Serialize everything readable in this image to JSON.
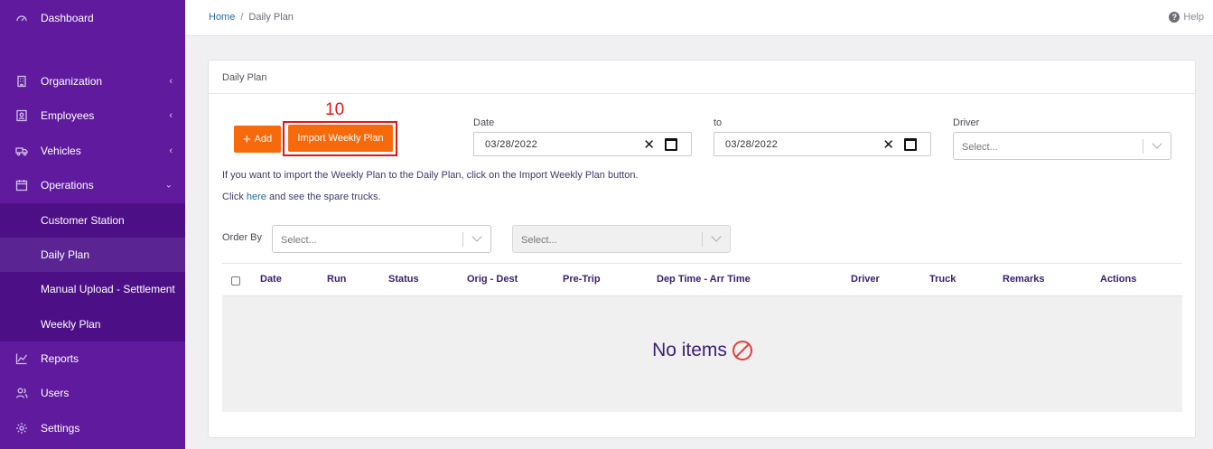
{
  "sidebar": {
    "items": [
      {
        "label": "Dashboard",
        "icon": "gauge-icon"
      },
      {
        "label": "Organization",
        "icon": "building-icon"
      },
      {
        "label": "Employees",
        "icon": "id-card-icon"
      },
      {
        "label": "Vehicles",
        "icon": "truck-icon"
      },
      {
        "label": "Operations",
        "icon": "calendar-icon"
      },
      {
        "label": "Reports",
        "icon": "chart-line-icon"
      },
      {
        "label": "Users",
        "icon": "users-icon"
      },
      {
        "label": "Settings",
        "icon": "gear-icon"
      }
    ],
    "submenu": [
      {
        "label": "Customer Station"
      },
      {
        "label": "Daily Plan",
        "active": true
      },
      {
        "label": "Manual Upload - Settlement"
      },
      {
        "label": "Weekly Plan"
      }
    ],
    "colors": {
      "bg": "#5f1a9e",
      "submenu_bg": "#4c0f86"
    }
  },
  "topbar": {
    "breadcrumb": {
      "home": "Home",
      "separator": "/",
      "current": "Daily Plan"
    },
    "help": "Help"
  },
  "card": {
    "title": "Daily Plan",
    "add_button": "Add",
    "import_button": "Import Weekly Plan",
    "step_number": "10",
    "date_label": "Date",
    "date_value": "03/28/2022",
    "to_label": "to",
    "to_value": "03/28/2022",
    "driver_label": "Driver",
    "driver_placeholder": "Select...",
    "info_line": "If you want to import the Weekly Plan to the Daily Plan, click on the Import Weekly Plan button.",
    "spare_prefix": "Click",
    "spare_link": "here",
    "spare_suffix": "and see the spare trucks.",
    "order_by_label": "Order By",
    "order_by_placeholder": "Select...",
    "order_dir_placeholder": "Select...",
    "table": {
      "columns": [
        "Date",
        "Run",
        "Status",
        "Orig - Dest",
        "Pre-Trip",
        "Dep Time - Arr Time",
        "Driver",
        "Truck",
        "Remarks",
        "Actions"
      ]
    },
    "empty_message": "No items",
    "accent": "#f76a0c"
  }
}
